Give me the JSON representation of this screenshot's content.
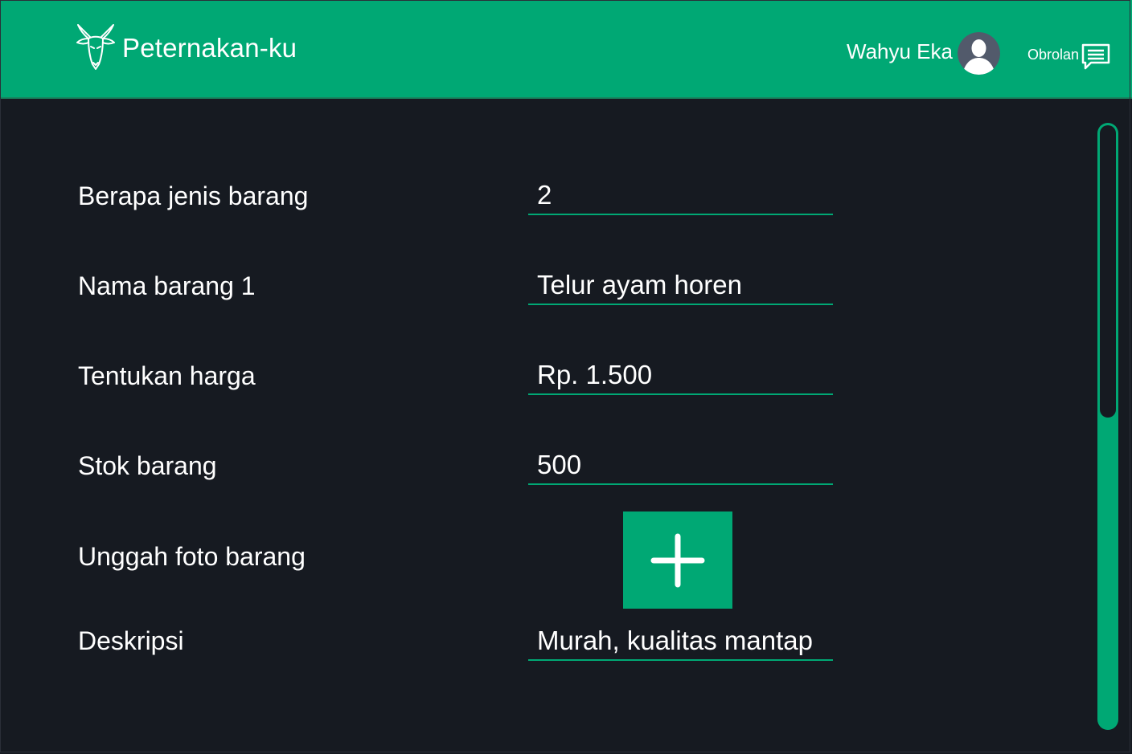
{
  "header": {
    "app_title": "Peternakan-ku",
    "user_name": "Wahyu Eka",
    "chat_label": "Obrolan",
    "logo_icon": "goat-head-icon",
    "avatar_icon": "user-avatar-icon",
    "chat_icon": "chat-bubble-icon",
    "background_color": "#00a874"
  },
  "form": {
    "item_types": {
      "label": "Berapa jenis barang",
      "value": "2"
    },
    "item_name": {
      "label": "Nama barang 1",
      "value": "Telur ayam horen"
    },
    "price": {
      "label": "Tentukan harga",
      "value": "Rp. 1.500"
    },
    "stock": {
      "label": "Stok barang",
      "value": "500"
    },
    "photo": {
      "label": "Unggah foto barang",
      "button_icon": "plus-icon"
    },
    "description": {
      "label": "Deskripsi",
      "value": "Murah, kualitas mantap"
    }
  },
  "theme": {
    "accent": "#00a874",
    "background": "#161a21",
    "text": "#ffffff"
  }
}
